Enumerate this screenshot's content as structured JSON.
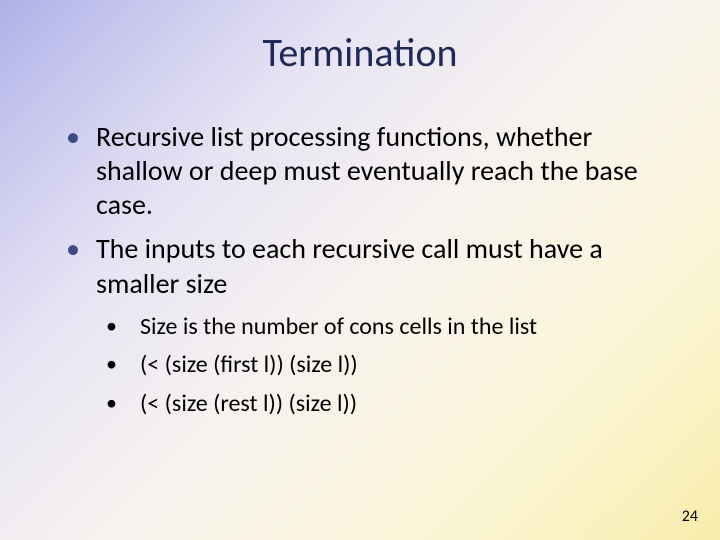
{
  "slide": {
    "title": "Termination",
    "bullets": [
      {
        "text": "Recursive list processing functions, whether shallow or deep must eventually reach the base case."
      },
      {
        "text": "The inputs to each recursive call must have a smaller size",
        "sub": [
          "Size is the number of cons cells in the list",
          "(< (size (first l)) (size l))",
          "(< (size (rest l)) (size l))"
        ]
      }
    ],
    "page_number": "24"
  }
}
